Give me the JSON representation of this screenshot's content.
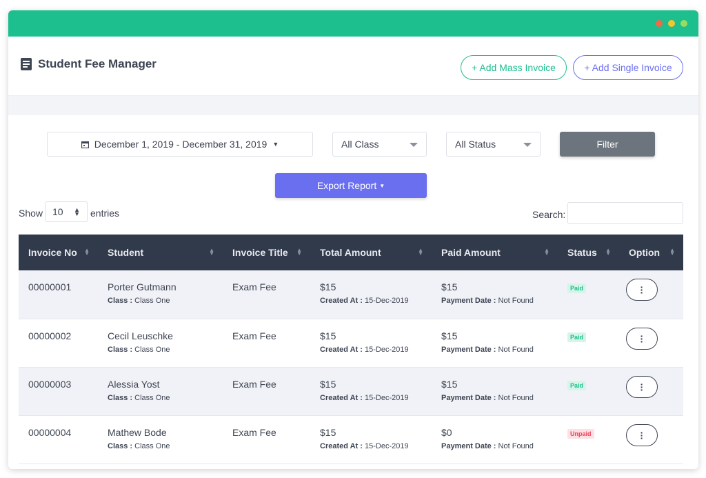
{
  "window": {
    "accent": "#1cbf8d",
    "dots": [
      "#f06a4a",
      "#f5c530",
      "#9adc5f"
    ]
  },
  "header": {
    "title": "Student Fee Manager",
    "add_mass_invoice": "+ Add Mass Invoice",
    "add_single_invoice": "+ Add Single Invoice"
  },
  "filters": {
    "date_range": "December 1, 2019 - December 31, 2019",
    "class_select": "All Class",
    "status_select": "All Status",
    "filter_button": "Filter",
    "export_button": "Export Report"
  },
  "table_controls": {
    "show_label": "Show",
    "page_length": "10",
    "entries_label": "entries",
    "search_label": "Search:",
    "search_value": ""
  },
  "table": {
    "columns": [
      "Invoice No",
      "Student",
      "Invoice Title",
      "Total Amount",
      "Paid Amount",
      "Status",
      "Option"
    ],
    "rows": [
      {
        "invoice_no": "00000001",
        "student": "Porter Gutmann",
        "class_label": "Class :",
        "class_value": "Class One",
        "title": "Exam Fee",
        "total": "$15",
        "created_label": "Created At :",
        "created_value": "15-Dec-2019",
        "paid": "$15",
        "payment_label": "Payment Date :",
        "payment_value": "Not Found",
        "status": "Paid"
      },
      {
        "invoice_no": "00000002",
        "student": "Cecil Leuschke",
        "class_label": "Class :",
        "class_value": "Class One",
        "title": "Exam Fee",
        "total": "$15",
        "created_label": "Created At :",
        "created_value": "15-Dec-2019",
        "paid": "$15",
        "payment_label": "Payment Date :",
        "payment_value": "Not Found",
        "status": "Paid"
      },
      {
        "invoice_no": "00000003",
        "student": "Alessia Yost",
        "class_label": "Class :",
        "class_value": "Class One",
        "title": "Exam Fee",
        "total": "$15",
        "created_label": "Created At :",
        "created_value": "15-Dec-2019",
        "paid": "$15",
        "payment_label": "Payment Date :",
        "payment_value": "Not Found",
        "status": "Paid"
      },
      {
        "invoice_no": "00000004",
        "student": "Mathew Bode",
        "class_label": "Class :",
        "class_value": "Class One",
        "title": "Exam Fee",
        "total": "$15",
        "created_label": "Created At :",
        "created_value": "15-Dec-2019",
        "paid": "$0",
        "payment_label": "Payment Date :",
        "payment_value": "Not Found",
        "status": "Unpaid"
      }
    ]
  }
}
